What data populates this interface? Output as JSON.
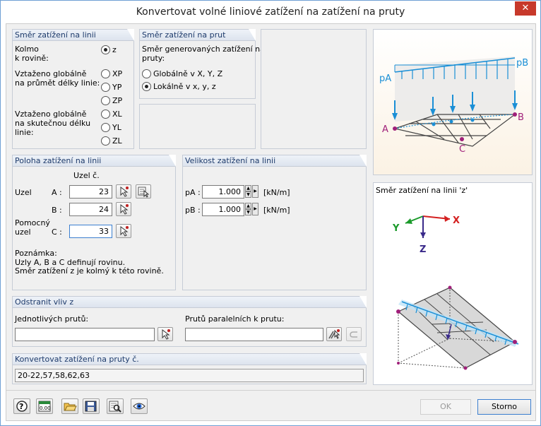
{
  "window": {
    "title": "Konvertovat volné liniové zatížení na zatížení na pruty",
    "close": "✕"
  },
  "smer_linie": {
    "title": "Směr zatížení na linii",
    "kolmo": "Kolmo\nk rovině:",
    "z": "z",
    "vztazeno_prumet": "Vztaženo globálně\nna průmět délky linie:",
    "xp": "XP",
    "yp": "YP",
    "zp": "ZP",
    "vztazeno_skut": "Vztaženo globálně\nna skutečnou délku\nlinie:",
    "xl": "XL",
    "yl": "YL",
    "zl": "ZL"
  },
  "smer_prut": {
    "title": "Směr zatížení na prut",
    "desc": "Směr generovaných zatížení na\npruty:",
    "global": "Globálně v X, Y, Z",
    "local": "Lokálně v x, y, z"
  },
  "poloha": {
    "title": "Poloha zatížení na linii",
    "uzel_c": "Uzel č.",
    "uzel": "Uzel",
    "a_label": "A :",
    "b_label": "B :",
    "pomocny": "Pomocný\nuzel",
    "c_label": "C :",
    "a_val": "23",
    "b_val": "24",
    "c_val": "33",
    "note": "Poznámka:\nUzly A, B a C definují rovinu.\nSměr zatížení z je kolmý k této rovině."
  },
  "velikost": {
    "title": "Velikost zatížení na linii",
    "pa": "pA :",
    "pb": "pB :",
    "pa_val": "1.000",
    "pb_val": "1.000",
    "unit_a": "[kN/m]",
    "unit_b": "[kN/m]"
  },
  "odstranit": {
    "title": "Odstranit vliv z",
    "jednotlivych": "Jednotlivých prutů:",
    "paralelnich": "Prutů paralelních k prutu:",
    "jed_val": "",
    "par_val": ""
  },
  "konvertovat": {
    "title": "Konvertovat zatížení na pruty č.",
    "value": "20-22,57,58,62,63"
  },
  "diagram1": {
    "pa": "pA",
    "pb": "pB",
    "a": "A",
    "b": "B",
    "c": "C"
  },
  "diagram2": {
    "title": "Směr zatížení na linii 'z'",
    "x": "X",
    "y": "Y",
    "z": "Z"
  },
  "buttons": {
    "ok": "OK",
    "storno": "Storno"
  },
  "colors": {
    "accent": "#1a8fd6",
    "axisX": "#d42020",
    "axisY": "#1a9a2a",
    "axisZ": "#3a2a8a",
    "node": "#a0207a"
  }
}
